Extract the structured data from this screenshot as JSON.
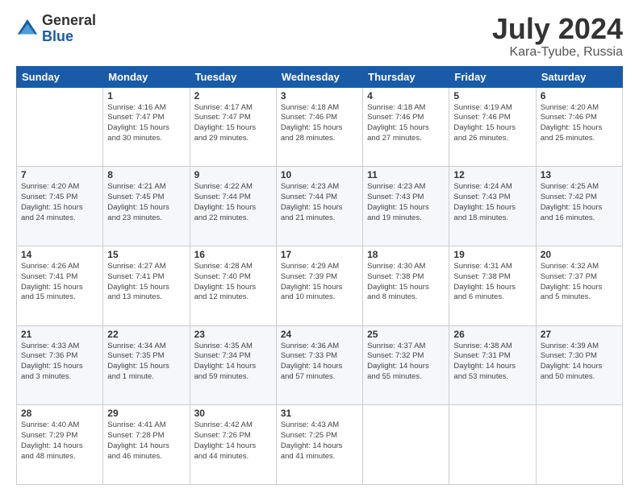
{
  "logo": {
    "general": "General",
    "blue": "Blue"
  },
  "title": {
    "month_year": "July 2024",
    "location": "Kara-Tyube, Russia"
  },
  "days_of_week": [
    "Sunday",
    "Monday",
    "Tuesday",
    "Wednesday",
    "Thursday",
    "Friday",
    "Saturday"
  ],
  "weeks": [
    [
      {
        "day": "",
        "sunrise": "",
        "sunset": "",
        "daylight": "",
        "empty": true
      },
      {
        "day": "1",
        "sunrise": "Sunrise: 4:16 AM",
        "sunset": "Sunset: 7:47 PM",
        "daylight": "Daylight: 15 hours and 30 minutes."
      },
      {
        "day": "2",
        "sunrise": "Sunrise: 4:17 AM",
        "sunset": "Sunset: 7:47 PM",
        "daylight": "Daylight: 15 hours and 29 minutes."
      },
      {
        "day": "3",
        "sunrise": "Sunrise: 4:18 AM",
        "sunset": "Sunset: 7:46 PM",
        "daylight": "Daylight: 15 hours and 28 minutes."
      },
      {
        "day": "4",
        "sunrise": "Sunrise: 4:18 AM",
        "sunset": "Sunset: 7:46 PM",
        "daylight": "Daylight: 15 hours and 27 minutes."
      },
      {
        "day": "5",
        "sunrise": "Sunrise: 4:19 AM",
        "sunset": "Sunset: 7:46 PM",
        "daylight": "Daylight: 15 hours and 26 minutes."
      },
      {
        "day": "6",
        "sunrise": "Sunrise: 4:20 AM",
        "sunset": "Sunset: 7:46 PM",
        "daylight": "Daylight: 15 hours and 25 minutes."
      }
    ],
    [
      {
        "day": "7",
        "sunrise": "Sunrise: 4:20 AM",
        "sunset": "Sunset: 7:45 PM",
        "daylight": "Daylight: 15 hours and 24 minutes."
      },
      {
        "day": "8",
        "sunrise": "Sunrise: 4:21 AM",
        "sunset": "Sunset: 7:45 PM",
        "daylight": "Daylight: 15 hours and 23 minutes."
      },
      {
        "day": "9",
        "sunrise": "Sunrise: 4:22 AM",
        "sunset": "Sunset: 7:44 PM",
        "daylight": "Daylight: 15 hours and 22 minutes."
      },
      {
        "day": "10",
        "sunrise": "Sunrise: 4:23 AM",
        "sunset": "Sunset: 7:44 PM",
        "daylight": "Daylight: 15 hours and 21 minutes."
      },
      {
        "day": "11",
        "sunrise": "Sunrise: 4:23 AM",
        "sunset": "Sunset: 7:43 PM",
        "daylight": "Daylight: 15 hours and 19 minutes."
      },
      {
        "day": "12",
        "sunrise": "Sunrise: 4:24 AM",
        "sunset": "Sunset: 7:43 PM",
        "daylight": "Daylight: 15 hours and 18 minutes."
      },
      {
        "day": "13",
        "sunrise": "Sunrise: 4:25 AM",
        "sunset": "Sunset: 7:42 PM",
        "daylight": "Daylight: 15 hours and 16 minutes."
      }
    ],
    [
      {
        "day": "14",
        "sunrise": "Sunrise: 4:26 AM",
        "sunset": "Sunset: 7:41 PM",
        "daylight": "Daylight: 15 hours and 15 minutes."
      },
      {
        "day": "15",
        "sunrise": "Sunrise: 4:27 AM",
        "sunset": "Sunset: 7:41 PM",
        "daylight": "Daylight: 15 hours and 13 minutes."
      },
      {
        "day": "16",
        "sunrise": "Sunrise: 4:28 AM",
        "sunset": "Sunset: 7:40 PM",
        "daylight": "Daylight: 15 hours and 12 minutes."
      },
      {
        "day": "17",
        "sunrise": "Sunrise: 4:29 AM",
        "sunset": "Sunset: 7:39 PM",
        "daylight": "Daylight: 15 hours and 10 minutes."
      },
      {
        "day": "18",
        "sunrise": "Sunrise: 4:30 AM",
        "sunset": "Sunset: 7:38 PM",
        "daylight": "Daylight: 15 hours and 8 minutes."
      },
      {
        "day": "19",
        "sunrise": "Sunrise: 4:31 AM",
        "sunset": "Sunset: 7:38 PM",
        "daylight": "Daylight: 15 hours and 6 minutes."
      },
      {
        "day": "20",
        "sunrise": "Sunrise: 4:32 AM",
        "sunset": "Sunset: 7:37 PM",
        "daylight": "Daylight: 15 hours and 5 minutes."
      }
    ],
    [
      {
        "day": "21",
        "sunrise": "Sunrise: 4:33 AM",
        "sunset": "Sunset: 7:36 PM",
        "daylight": "Daylight: 15 hours and 3 minutes."
      },
      {
        "day": "22",
        "sunrise": "Sunrise: 4:34 AM",
        "sunset": "Sunset: 7:35 PM",
        "daylight": "Daylight: 15 hours and 1 minute."
      },
      {
        "day": "23",
        "sunrise": "Sunrise: 4:35 AM",
        "sunset": "Sunset: 7:34 PM",
        "daylight": "Daylight: 14 hours and 59 minutes."
      },
      {
        "day": "24",
        "sunrise": "Sunrise: 4:36 AM",
        "sunset": "Sunset: 7:33 PM",
        "daylight": "Daylight: 14 hours and 57 minutes."
      },
      {
        "day": "25",
        "sunrise": "Sunrise: 4:37 AM",
        "sunset": "Sunset: 7:32 PM",
        "daylight": "Daylight: 14 hours and 55 minutes."
      },
      {
        "day": "26",
        "sunrise": "Sunrise: 4:38 AM",
        "sunset": "Sunset: 7:31 PM",
        "daylight": "Daylight: 14 hours and 53 minutes."
      },
      {
        "day": "27",
        "sunrise": "Sunrise: 4:39 AM",
        "sunset": "Sunset: 7:30 PM",
        "daylight": "Daylight: 14 hours and 50 minutes."
      }
    ],
    [
      {
        "day": "28",
        "sunrise": "Sunrise: 4:40 AM",
        "sunset": "Sunset: 7:29 PM",
        "daylight": "Daylight: 14 hours and 48 minutes."
      },
      {
        "day": "29",
        "sunrise": "Sunrise: 4:41 AM",
        "sunset": "Sunset: 7:28 PM",
        "daylight": "Daylight: 14 hours and 46 minutes."
      },
      {
        "day": "30",
        "sunrise": "Sunrise: 4:42 AM",
        "sunset": "Sunset: 7:26 PM",
        "daylight": "Daylight: 14 hours and 44 minutes."
      },
      {
        "day": "31",
        "sunrise": "Sunrise: 4:43 AM",
        "sunset": "Sunset: 7:25 PM",
        "daylight": "Daylight: 14 hours and 41 minutes."
      },
      {
        "day": "",
        "sunrise": "",
        "sunset": "",
        "daylight": "",
        "empty": true
      },
      {
        "day": "",
        "sunrise": "",
        "sunset": "",
        "daylight": "",
        "empty": true
      },
      {
        "day": "",
        "sunrise": "",
        "sunset": "",
        "daylight": "",
        "empty": true
      }
    ]
  ]
}
